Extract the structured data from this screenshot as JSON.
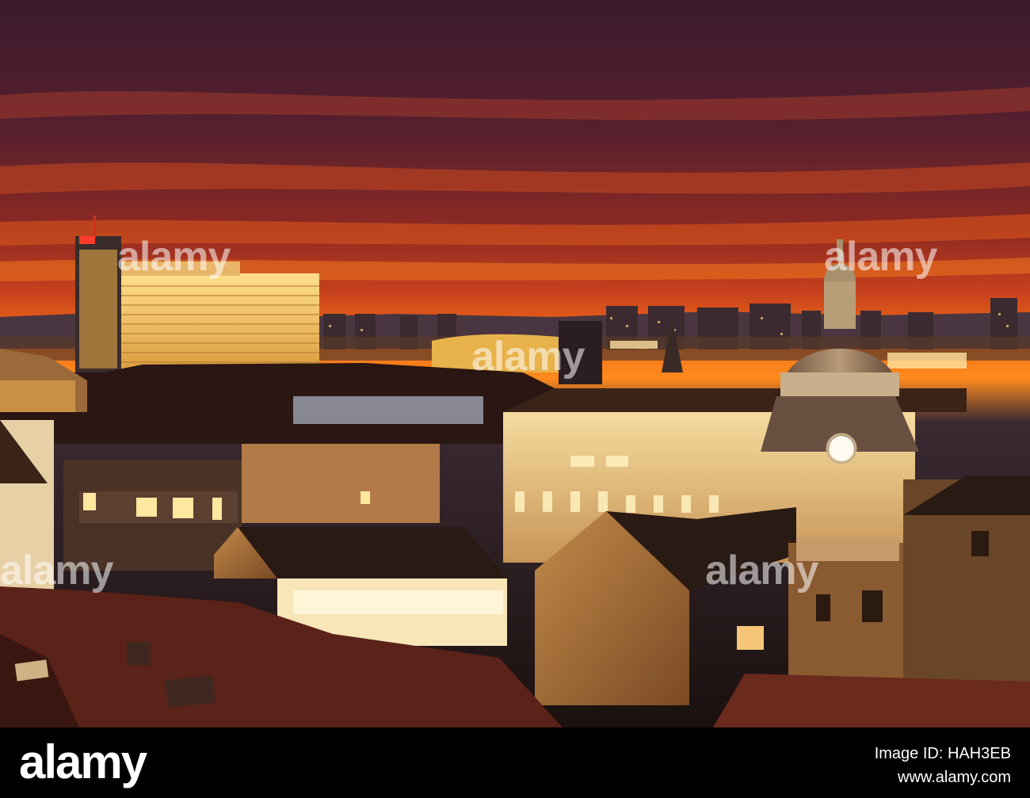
{
  "photo": {
    "subject": "city-skyline-at-sunset",
    "watermark_text": "alamy",
    "colors": {
      "sky_top": "#3a1a2e",
      "sky_mid": "#b5321f",
      "sky_glow": "#ff6a14",
      "roof_dark": "#2a1410",
      "light_warm": "#ffd27a"
    }
  },
  "footer": {
    "brand": "alamy",
    "image_id_label": "Image ID: HAH3EB",
    "url": "www.alamy.com",
    "background": "#000000"
  }
}
